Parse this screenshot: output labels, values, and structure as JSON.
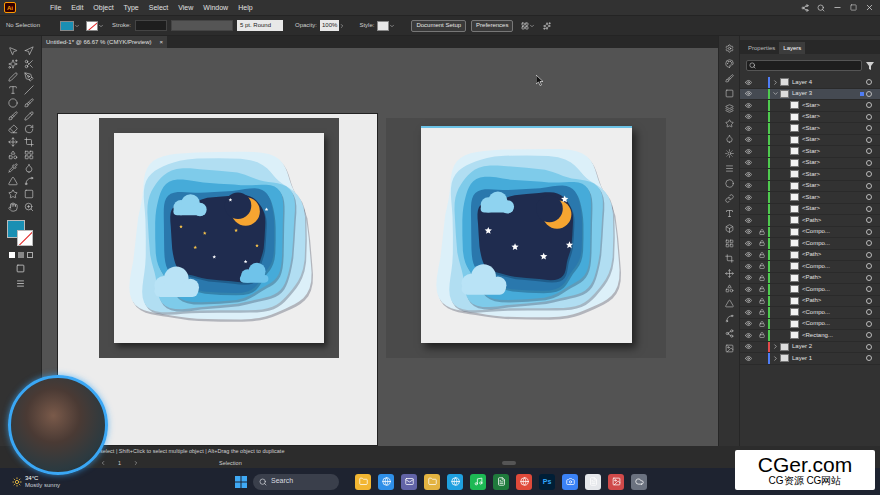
{
  "app": {
    "logo": "Ai"
  },
  "menu": [
    "File",
    "Edit",
    "Object",
    "Type",
    "Select",
    "View",
    "Window",
    "Help"
  ],
  "control_bar": {
    "selection": "No Selection",
    "stroke_label": "Stroke:",
    "brush": "5 pt. Round",
    "opacity_label": "Opacity:",
    "opacity": "100%",
    "style_label": "Style:",
    "buttons": [
      "Document Setup",
      "Preferences"
    ]
  },
  "document_tab": {
    "title": "Untitled-1* @ 66.67 % (CMYK/Preview)",
    "close": "×"
  },
  "panel_tabs": [
    {
      "label": "Properties",
      "selected": false
    },
    {
      "label": "Layers",
      "selected": true
    }
  ],
  "layers": [
    {
      "name": "Layer 4",
      "kind": "layer",
      "expanded": false,
      "selected": false,
      "visible": true,
      "locked": false,
      "color": "#4f7df5"
    },
    {
      "name": "Layer 3",
      "kind": "layer",
      "expanded": true,
      "selected": true,
      "visible": true,
      "locked": false,
      "color": "#4fcb4f"
    },
    {
      "name": "<Star>",
      "kind": "object",
      "selected": false,
      "visible": true,
      "locked": false
    },
    {
      "name": "<Star>",
      "kind": "object",
      "selected": false,
      "visible": true,
      "locked": false
    },
    {
      "name": "<Star>",
      "kind": "object",
      "selected": false,
      "visible": true,
      "locked": false
    },
    {
      "name": "<Star>",
      "kind": "object",
      "selected": false,
      "visible": true,
      "locked": false
    },
    {
      "name": "<Star>",
      "kind": "object",
      "selected": false,
      "visible": true,
      "locked": false
    },
    {
      "name": "<Star>",
      "kind": "object",
      "selected": false,
      "visible": true,
      "locked": false
    },
    {
      "name": "<Star>",
      "kind": "object",
      "selected": false,
      "visible": true,
      "locked": false
    },
    {
      "name": "<Star>",
      "kind": "object",
      "selected": false,
      "visible": true,
      "locked": false
    },
    {
      "name": "<Star>",
      "kind": "object",
      "selected": false,
      "visible": true,
      "locked": false
    },
    {
      "name": "<Star>",
      "kind": "object",
      "selected": false,
      "visible": true,
      "locked": false
    },
    {
      "name": "<Path>",
      "kind": "object",
      "selected": false,
      "visible": true,
      "locked": false
    },
    {
      "name": "<Compo...",
      "kind": "object",
      "selected": false,
      "visible": true,
      "locked": true
    },
    {
      "name": "<Compo...",
      "kind": "object",
      "selected": false,
      "visible": true,
      "locked": true
    },
    {
      "name": "<Path>",
      "kind": "object",
      "selected": false,
      "visible": true,
      "locked": true
    },
    {
      "name": "<Compo...",
      "kind": "object",
      "selected": false,
      "visible": true,
      "locked": true
    },
    {
      "name": "<Path>",
      "kind": "object",
      "selected": false,
      "visible": true,
      "locked": true
    },
    {
      "name": "<Compo...",
      "kind": "object",
      "selected": false,
      "visible": true,
      "locked": true
    },
    {
      "name": "<Path>",
      "kind": "object",
      "selected": false,
      "visible": true,
      "locked": true
    },
    {
      "name": "<Compo...",
      "kind": "object",
      "selected": false,
      "visible": true,
      "locked": true
    },
    {
      "name": "<Compo...",
      "kind": "object",
      "selected": false,
      "visible": true,
      "locked": true
    },
    {
      "name": "<Rectang...",
      "kind": "object",
      "selected": false,
      "visible": true,
      "locked": true
    },
    {
      "name": "Layer 2",
      "kind": "layer",
      "expanded": false,
      "selected": false,
      "visible": true,
      "locked": false,
      "color": "#e24c4c"
    },
    {
      "name": "Layer 1",
      "kind": "layer",
      "expanded": false,
      "selected": false,
      "visible": true,
      "locked": false,
      "color": "#4f7df5"
    }
  ],
  "status_bar": {
    "hint": "select | Shift+Click to select multiple object | Alt+Drag the object to duplicate",
    "artboard": "1",
    "tool": "Selection"
  },
  "taskbar": {
    "temperature": "34°C",
    "weather": "Mostly sunny",
    "search": "Search",
    "app_label": "Ps"
  },
  "watermark": {
    "title": "CGer.com",
    "subtitle": "CG资源 CG网站"
  }
}
